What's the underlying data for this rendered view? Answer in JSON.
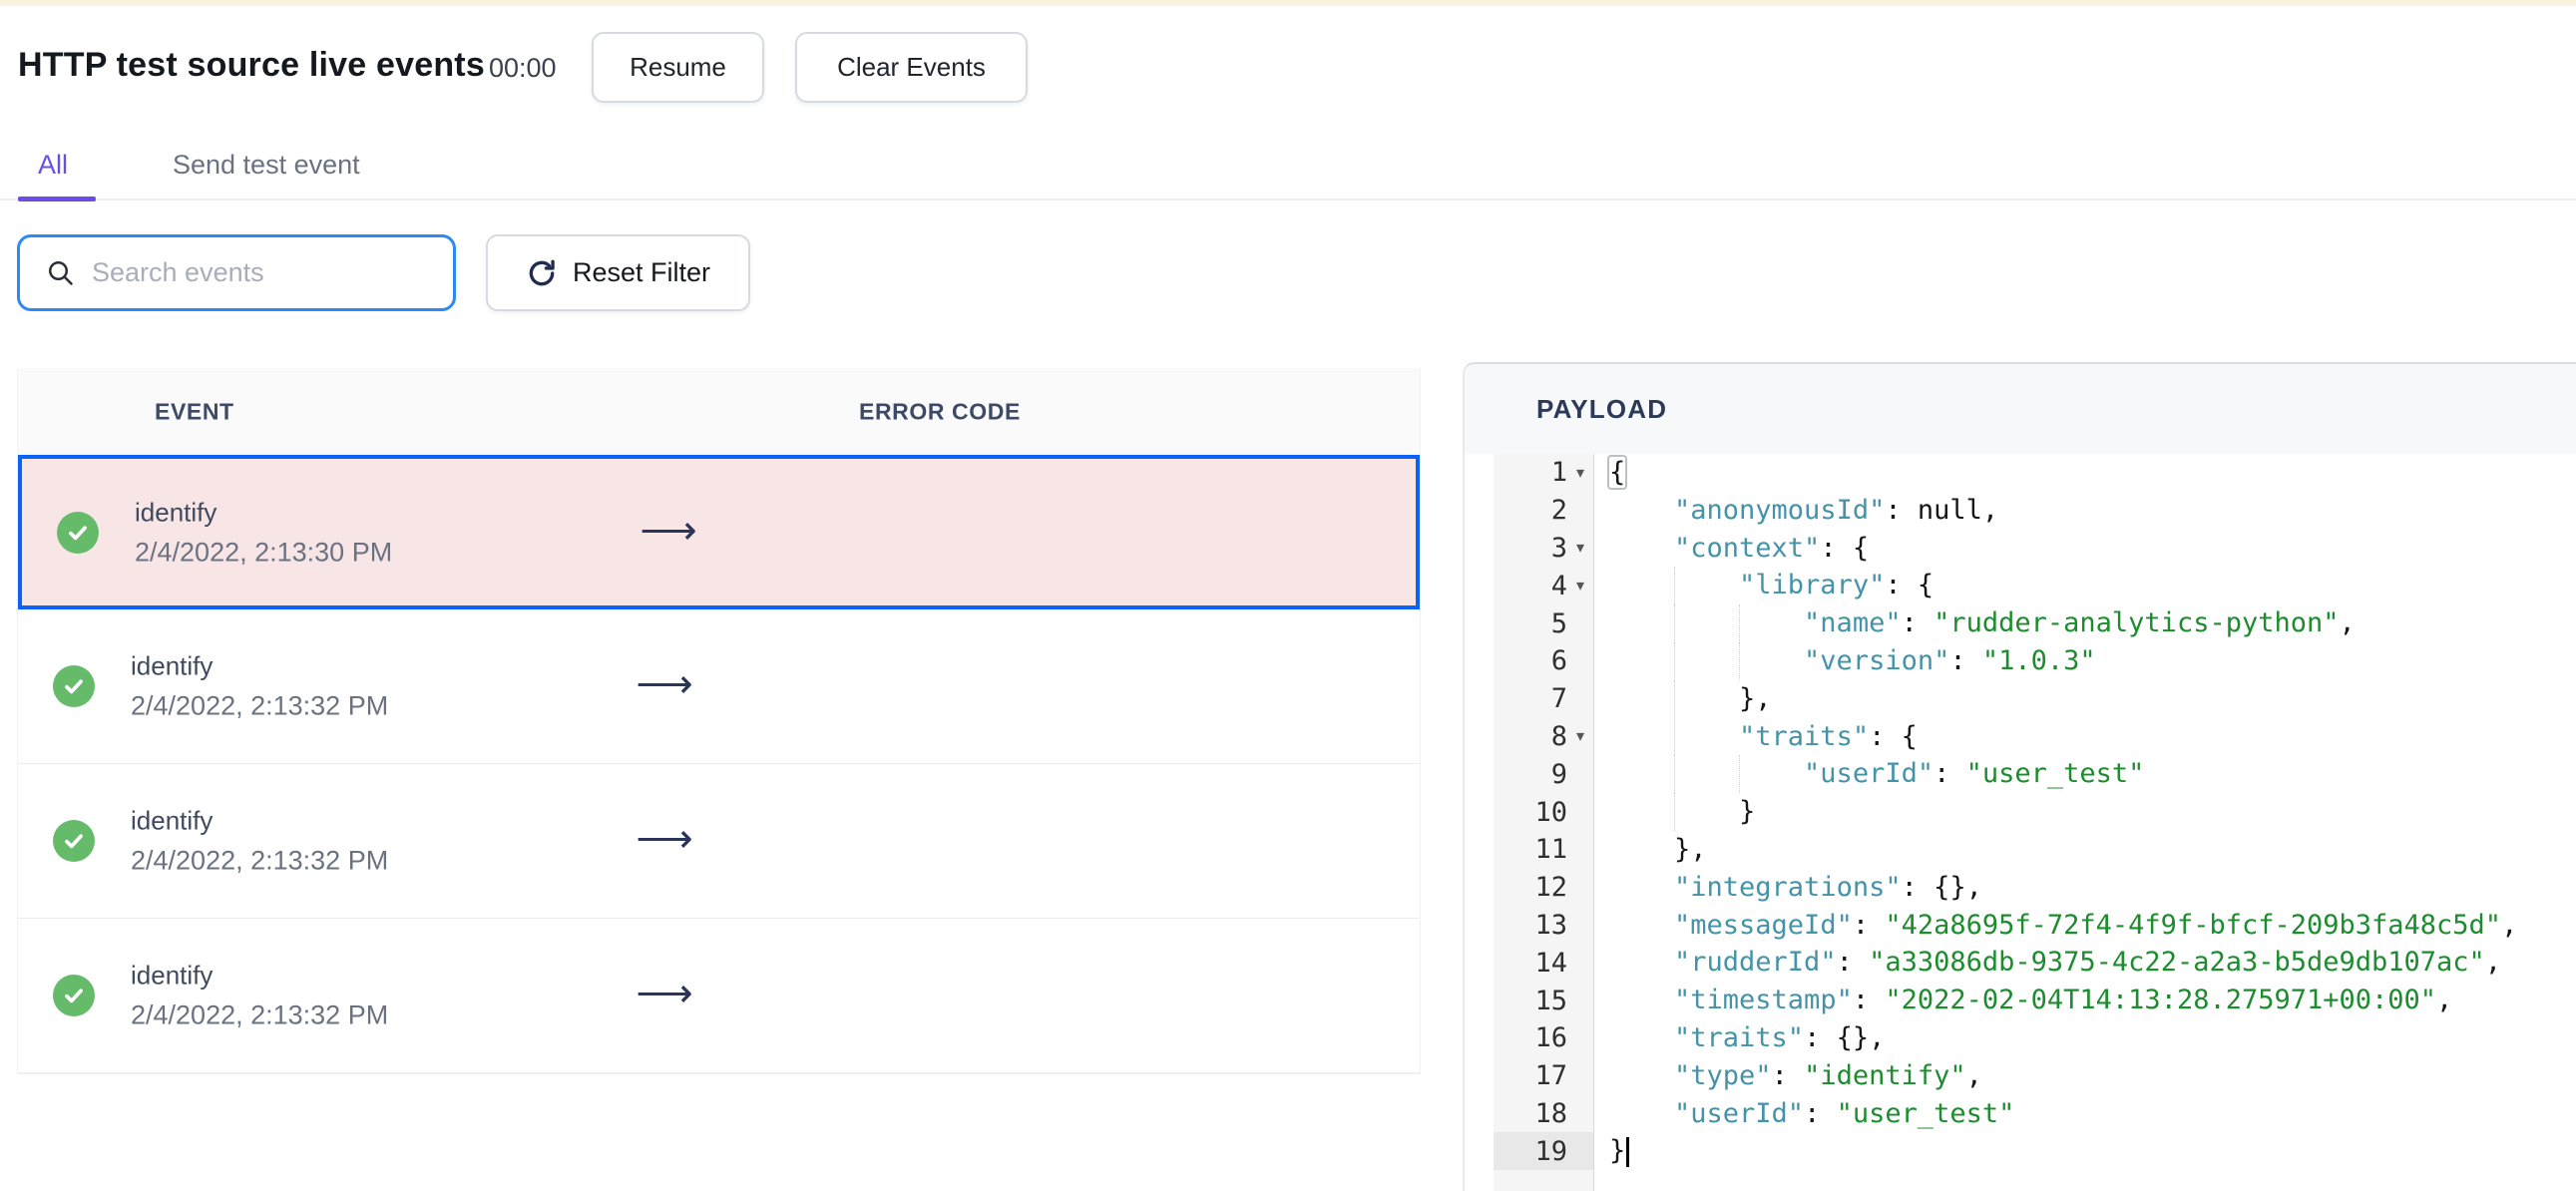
{
  "page": {
    "title": "HTTP test source live events",
    "timer": "00:00",
    "resume_label": "Resume",
    "clear_label": "Clear Events"
  },
  "tabs": {
    "all_label": "All",
    "send_label": "Send test event"
  },
  "toolbar": {
    "search_placeholder": "Search events",
    "reset_label": "Reset Filter"
  },
  "events": {
    "columns": {
      "event": "EVENT",
      "error": "ERROR CODE"
    },
    "rows": [
      {
        "type": "identify",
        "timestamp": "2/4/2022, 2:13:30 PM",
        "status": "success",
        "selected": true
      },
      {
        "type": "identify",
        "timestamp": "2/4/2022, 2:13:32 PM",
        "status": "success",
        "selected": false
      },
      {
        "type": "identify",
        "timestamp": "2/4/2022, 2:13:32 PM",
        "status": "success",
        "selected": false
      },
      {
        "type": "identify",
        "timestamp": "2/4/2022, 2:13:32 PM",
        "status": "success",
        "selected": false
      }
    ]
  },
  "payload": {
    "heading": "PAYLOAD",
    "lines": [
      {
        "n": 1,
        "indent": 0,
        "fold": true,
        "tokens": [
          {
            "t": "match",
            "v": "{"
          }
        ]
      },
      {
        "n": 2,
        "indent": 1,
        "tokens": [
          {
            "t": "k",
            "v": "\"anonymousId\""
          },
          {
            "t": "p",
            "v": ": null,"
          }
        ]
      },
      {
        "n": 3,
        "indent": 1,
        "fold": true,
        "tokens": [
          {
            "t": "k",
            "v": "\"context\""
          },
          {
            "t": "p",
            "v": ": {"
          }
        ]
      },
      {
        "n": 4,
        "indent": 2,
        "fold": true,
        "tokens": [
          {
            "t": "k",
            "v": "\"library\""
          },
          {
            "t": "p",
            "v": ": {"
          }
        ]
      },
      {
        "n": 5,
        "indent": 3,
        "tokens": [
          {
            "t": "k",
            "v": "\"name\""
          },
          {
            "t": "p",
            "v": ": "
          },
          {
            "t": "s",
            "v": "\"rudder-analytics-python\""
          },
          {
            "t": "p",
            "v": ","
          }
        ]
      },
      {
        "n": 6,
        "indent": 3,
        "tokens": [
          {
            "t": "k",
            "v": "\"version\""
          },
          {
            "t": "p",
            "v": ": "
          },
          {
            "t": "s",
            "v": "\"1.0.3\""
          }
        ]
      },
      {
        "n": 7,
        "indent": 2,
        "tokens": [
          {
            "t": "p",
            "v": "},"
          }
        ]
      },
      {
        "n": 8,
        "indent": 2,
        "fold": true,
        "tokens": [
          {
            "t": "k",
            "v": "\"traits\""
          },
          {
            "t": "p",
            "v": ": {"
          }
        ]
      },
      {
        "n": 9,
        "indent": 3,
        "tokens": [
          {
            "t": "k",
            "v": "\"userId\""
          },
          {
            "t": "p",
            "v": ": "
          },
          {
            "t": "s",
            "v": "\"user_test\""
          }
        ]
      },
      {
        "n": 10,
        "indent": 2,
        "tokens": [
          {
            "t": "p",
            "v": "}"
          }
        ]
      },
      {
        "n": 11,
        "indent": 1,
        "tokens": [
          {
            "t": "p",
            "v": "},"
          }
        ]
      },
      {
        "n": 12,
        "indent": 1,
        "tokens": [
          {
            "t": "k",
            "v": "\"integrations\""
          },
          {
            "t": "p",
            "v": ": {},"
          }
        ]
      },
      {
        "n": 13,
        "indent": 1,
        "tokens": [
          {
            "t": "k",
            "v": "\"messageId\""
          },
          {
            "t": "p",
            "v": ": "
          },
          {
            "t": "s",
            "v": "\"42a8695f-72f4-4f9f-bfcf-209b3fa48c5d\""
          },
          {
            "t": "p",
            "v": ","
          }
        ]
      },
      {
        "n": 14,
        "indent": 1,
        "tokens": [
          {
            "t": "k",
            "v": "\"rudderId\""
          },
          {
            "t": "p",
            "v": ": "
          },
          {
            "t": "s",
            "v": "\"a33086db-9375-4c22-a2a3-b5de9db107ac\""
          },
          {
            "t": "p",
            "v": ","
          }
        ]
      },
      {
        "n": 15,
        "indent": 1,
        "tokens": [
          {
            "t": "k",
            "v": "\"timestamp\""
          },
          {
            "t": "p",
            "v": ": "
          },
          {
            "t": "s",
            "v": "\"2022-02-04T14:13:28.275971+00:00\""
          },
          {
            "t": "p",
            "v": ","
          }
        ]
      },
      {
        "n": 16,
        "indent": 1,
        "tokens": [
          {
            "t": "k",
            "v": "\"traits\""
          },
          {
            "t": "p",
            "v": ": {},"
          }
        ]
      },
      {
        "n": 17,
        "indent": 1,
        "tokens": [
          {
            "t": "k",
            "v": "\"type\""
          },
          {
            "t": "p",
            "v": ": "
          },
          {
            "t": "s",
            "v": "\"identify\""
          },
          {
            "t": "p",
            "v": ","
          }
        ]
      },
      {
        "n": 18,
        "indent": 1,
        "tokens": [
          {
            "t": "k",
            "v": "\"userId\""
          },
          {
            "t": "p",
            "v": ": "
          },
          {
            "t": "s",
            "v": "\"user_test\""
          }
        ]
      },
      {
        "n": 19,
        "indent": 0,
        "active": true,
        "caret": true,
        "tokens": [
          {
            "t": "p",
            "v": "}"
          }
        ]
      }
    ]
  },
  "icons": {
    "search": "magnifier-icon",
    "reset": "refresh-icon",
    "row_status": "check-circle-icon",
    "row_arrow": "long-right-arrow-icon",
    "fold": "chevron-down-icon",
    "arrow_glyph": "⟶",
    "fold_glyph": "▾"
  },
  "colors": {
    "accent_purple": "#6B4EE6",
    "focus_blue": "#2E89F5",
    "selected_border": "#0A63F6",
    "selected_bg": "#F8E6E6",
    "success_green": "#66BB6A",
    "json_key": "#4493A8",
    "json_string": "#1C8C2E",
    "cream_bar": "#FBF3DE",
    "arrow_navy": "#2A3558"
  }
}
